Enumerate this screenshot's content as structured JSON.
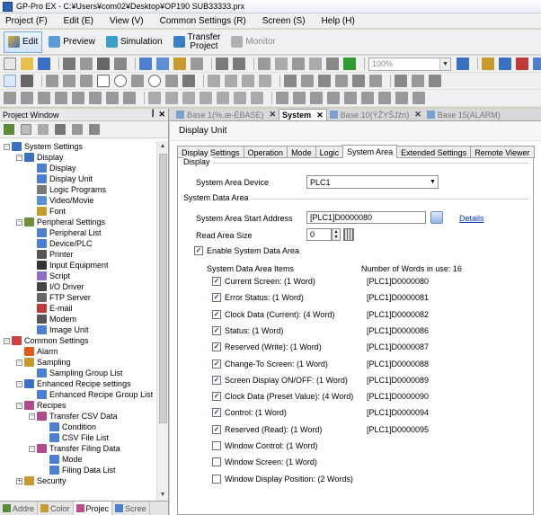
{
  "window": {
    "title": "GP-Pro EX - C:¥Users¥com02¥Desktop¥OP190 SUB33333.prx"
  },
  "menu": [
    "Project (F)",
    "Edit (E)",
    "View (V)",
    "Common Settings (R)",
    "Screen (S)",
    "Help (H)"
  ],
  "modes": {
    "edit": "Edit",
    "preview": "Preview",
    "simulation": "Simulation",
    "transfer_l1": "Transfer",
    "transfer_l2": "Project",
    "monitor": "Monitor"
  },
  "zoom": {
    "value": "100%"
  },
  "project_window": {
    "title": "Project Window",
    "tree": [
      {
        "label": "System Settings",
        "level": 0,
        "exp": "-",
        "color": "#3a6fc4"
      },
      {
        "label": "Display",
        "level": 1,
        "exp": "-",
        "color": "#3a6fc4"
      },
      {
        "label": "Display",
        "level": 2,
        "exp": "",
        "color": "#4c7fd0"
      },
      {
        "label": "Display Unit",
        "level": 2,
        "exp": "",
        "color": "#4c7fd0"
      },
      {
        "label": "Logic Programs",
        "level": 2,
        "exp": "",
        "color": "#7a7a7a"
      },
      {
        "label": "Video/Movie",
        "level": 2,
        "exp": "",
        "color": "#5b8fd6"
      },
      {
        "label": "Font",
        "level": 2,
        "exp": "",
        "color": "#c79a2e"
      },
      {
        "label": "Peripheral Settings",
        "level": 1,
        "exp": "-",
        "color": "#6d8e3a"
      },
      {
        "label": "Peripheral List",
        "level": 2,
        "exp": "",
        "color": "#4c7fd0"
      },
      {
        "label": "Device/PLC",
        "level": 2,
        "exp": "",
        "color": "#4c7fd0"
      },
      {
        "label": "Printer",
        "level": 2,
        "exp": "",
        "color": "#555555"
      },
      {
        "label": "Input Equipment",
        "level": 2,
        "exp": "",
        "color": "#333333"
      },
      {
        "label": "Script",
        "level": 2,
        "exp": "",
        "color": "#8e6cc4"
      },
      {
        "label": "I/O Driver",
        "level": 2,
        "exp": "",
        "color": "#444444"
      },
      {
        "label": "FTP Server",
        "level": 2,
        "exp": "",
        "color": "#666666"
      },
      {
        "label": "E-mail",
        "level": 2,
        "exp": "",
        "color": "#c03a3a"
      },
      {
        "label": "Modem",
        "level": 2,
        "exp": "",
        "color": "#555555"
      },
      {
        "label": "Image Unit",
        "level": 2,
        "exp": "",
        "color": "#4c7fd0"
      },
      {
        "label": "Common Settings",
        "level": 0,
        "exp": "-",
        "color": "#d04040"
      },
      {
        "label": "Alarm",
        "level": 1,
        "exp": "",
        "color": "#e05a1a"
      },
      {
        "label": "Sampling",
        "level": 1,
        "exp": "-",
        "color": "#c79a2e"
      },
      {
        "label": "Sampling Group List",
        "level": 2,
        "exp": "",
        "color": "#4c7fd0"
      },
      {
        "label": "Enhanced Recipe settings",
        "level": 1,
        "exp": "-",
        "color": "#3a6fc4"
      },
      {
        "label": "Enhanced Recipe Group List",
        "level": 2,
        "exp": "",
        "color": "#4c7fd0"
      },
      {
        "label": "Recipes",
        "level": 1,
        "exp": "-",
        "color": "#b04a8a"
      },
      {
        "label": "Transfer CSV Data",
        "level": 2,
        "exp": "-",
        "color": "#b04a8a"
      },
      {
        "label": "Condition",
        "level": 3,
        "exp": "",
        "color": "#4c7fd0"
      },
      {
        "label": "CSV File List",
        "level": 3,
        "exp": "",
        "color": "#4c7fd0"
      },
      {
        "label": "Transfer Filing Data",
        "level": 2,
        "exp": "-",
        "color": "#b04a8a"
      },
      {
        "label": "Mode",
        "level": 3,
        "exp": "",
        "color": "#4c7fd0"
      },
      {
        "label": "Filing Data List",
        "level": 3,
        "exp": "",
        "color": "#4c7fd0"
      },
      {
        "label": "Security",
        "level": 1,
        "exp": "+",
        "color": "#c79a2e"
      }
    ],
    "bottom_tabs": [
      "Addre",
      "Color",
      "Projec",
      "Scree"
    ]
  },
  "doc_tabs": [
    "Base 1(%.æ-ÉBASE)",
    "System",
    "Base 10(ÝŽYŠJžn)",
    "Base 15(ALARM)"
  ],
  "panel": {
    "title": "Display Unit",
    "tabs": [
      "Display Settings",
      "Operation",
      "Mode",
      "Logic",
      "System Area",
      "Extended Settings",
      "Remote Viewer"
    ],
    "display_section": "Display",
    "system_area_device_label": "System Area Device",
    "system_area_device_value": "PLC1",
    "system_data_area_section": "System Data Area",
    "start_address_label": "System Area Start Address",
    "start_address_value": "[PLC1]D0000080",
    "details_link": "Details",
    "read_area_size_label": "Read Area Size",
    "read_area_size_value": "0",
    "enable_label": "Enable System Data Area",
    "items_header": "System Data Area Items",
    "words_in_use": "Number of Words in use: 16",
    "items": [
      {
        "label": "Current Screen: (1 Word)",
        "addr": "[PLC1]D0000080",
        "checked": true
      },
      {
        "label": "Error Status: (1 Word)",
        "addr": "[PLC1]D0000081",
        "checked": true
      },
      {
        "label": "Clock Data (Current): (4 Word)",
        "addr": "[PLC1]D0000082",
        "checked": true
      },
      {
        "label": "Status: (1 Word)",
        "addr": "[PLC1]D0000086",
        "checked": true
      },
      {
        "label": "Reserved (Write): (1 Word)",
        "addr": "[PLC1]D0000087",
        "checked": true
      },
      {
        "label": "Change-To Screen: (1 Word)",
        "addr": "[PLC1]D0000088",
        "checked": true
      },
      {
        "label": "Screen Display ON/OFF: (1 Word)",
        "addr": "[PLC1]D0000089",
        "checked": true
      },
      {
        "label": "Clock Data (Preset Value): (4 Word)",
        "addr": "[PLC1]D0000090",
        "checked": true
      },
      {
        "label": "Control: (1 Word)",
        "addr": "[PLC1]D0000094",
        "checked": true
      },
      {
        "label": "Reserved (Read): (1 Word)",
        "addr": "[PLC1]D0000095",
        "checked": true
      },
      {
        "label": "Window Control: (1 Word)",
        "addr": "",
        "checked": false
      },
      {
        "label": "Window Screen: (1 Word)",
        "addr": "",
        "checked": false
      },
      {
        "label": "Window Display Position: (2 Words)",
        "addr": "",
        "checked": false
      }
    ]
  },
  "colors": {
    "accent": "#3a6fc4",
    "link": "#0033cc"
  }
}
